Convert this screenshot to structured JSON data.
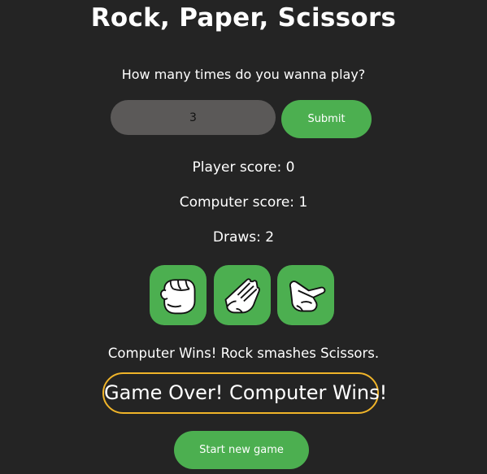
{
  "title": "Rock, Paper, Scissors",
  "prompt": "How many times do you wanna play?",
  "rounds_input": {
    "value": "3"
  },
  "submit_label": "Submit",
  "scores": {
    "player": "Player score: 0",
    "computer": "Computer score: 1",
    "draws": "Draws: 2"
  },
  "choices": [
    {
      "name": "rock",
      "icon": "rock-hand-icon"
    },
    {
      "name": "paper",
      "icon": "paper-hand-icon"
    },
    {
      "name": "scissors",
      "icon": "scissors-hand-icon"
    }
  ],
  "round_result": "Computer Wins! Rock smashes Scissors.",
  "game_over": "Game Over! Computer Wins!",
  "restart_label": "Start new game",
  "colors": {
    "background": "#242424",
    "accent": "#4caf50",
    "game_over_border": "#f0b429",
    "input_bg": "#5b5958"
  }
}
